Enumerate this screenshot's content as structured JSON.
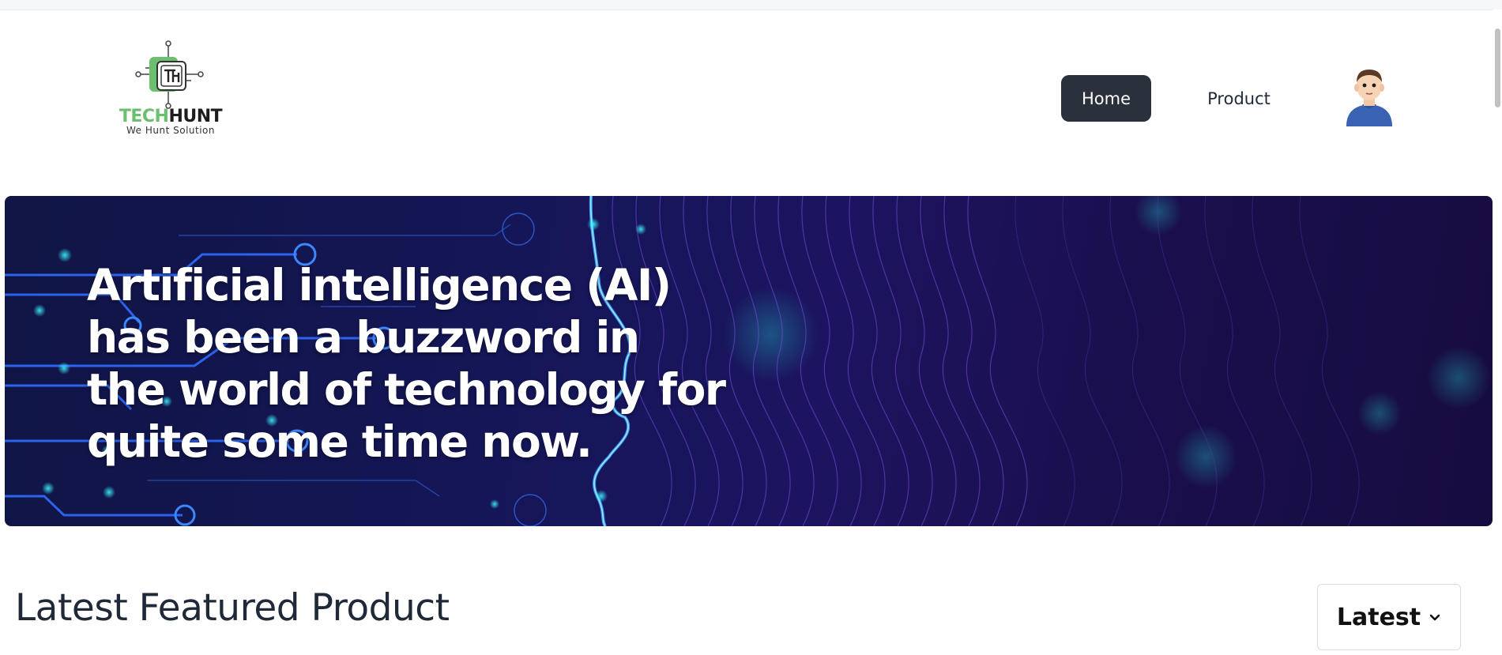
{
  "logo": {
    "brand_part1": "TECH",
    "brand_part2": "HUNT",
    "tagline": "We Hunt Solution",
    "icon_name": "chip-logo-icon"
  },
  "nav": {
    "home_label": "Home",
    "product_label": "Product",
    "avatar_icon": "user-avatar-icon"
  },
  "hero": {
    "text": "Artificial intelligence (AI) has been a buzzword in the world of technology for quite some time now."
  },
  "featured": {
    "title": "Latest Featured Product",
    "sort_selected": "Latest",
    "sort_icon": "chevron-down-icon"
  },
  "colors": {
    "nav_active_bg": "#2a303c",
    "brand_green": "#6cbf6f",
    "banner_bg": "#15164f"
  }
}
